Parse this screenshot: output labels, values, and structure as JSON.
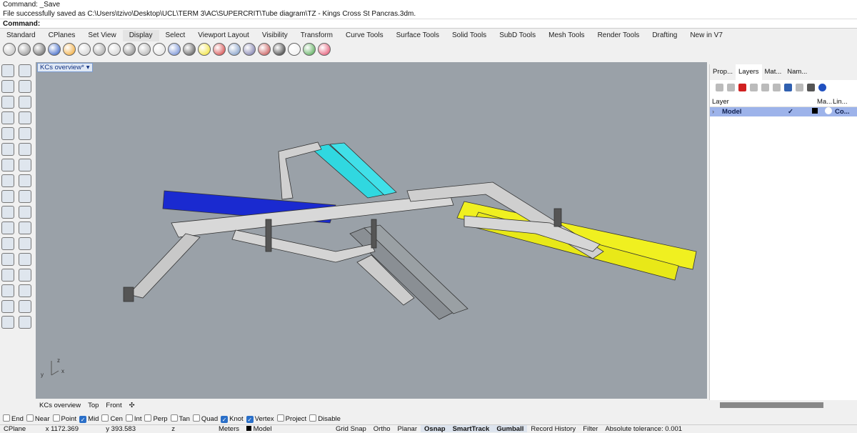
{
  "command": {
    "line1": "Command: _Save",
    "line2": "File successfully saved as C:\\Users\\tzivo\\Desktop\\UCL\\TERM 3\\AC\\SUPERCRIT\\Tube diagram\\TZ - Kings Cross St Pancras.3dm.",
    "prompt": "Command:"
  },
  "toolbar_tabs": [
    "Standard",
    "CPlanes",
    "Set View",
    "Display",
    "Select",
    "Viewport Layout",
    "Visibility",
    "Transform",
    "Curve Tools",
    "Surface Tools",
    "Solid Tools",
    "SubD Tools",
    "Mesh Tools",
    "Render Tools",
    "Drafting",
    "New in V7"
  ],
  "active_toolbar_tab": "Display",
  "display_icons": [
    "#b8b8b8",
    "#888",
    "#555",
    "#2050c0",
    "#f0a020",
    "#ccc",
    "#999",
    "#ccc",
    "#777",
    "#aaa",
    "#ddd",
    "#6080d0",
    "#444",
    "#f0e020",
    "#d03030",
    "#7090c0",
    "#6a6aa0",
    "#c04040",
    "#222",
    "#eee",
    "#40a040",
    "#e04060"
  ],
  "viewport": {
    "title": "KCs overview*",
    "background": "#9aa1a8",
    "axis_labels": {
      "z": "z",
      "y": "y",
      "x": "x"
    }
  },
  "panel": {
    "tabs": [
      "Prop...",
      "Layers",
      "Mat...",
      "Nam..."
    ],
    "active_tab": "Layers",
    "columns": [
      "Layer",
      "Ma...",
      "Lin..."
    ],
    "layers": [
      {
        "name": "Model",
        "current": "✓",
        "linetype": "Co..."
      }
    ]
  },
  "viewport_tabs": [
    "KCs overview",
    "Top",
    "Front"
  ],
  "osnap": [
    {
      "label": "End",
      "checked": false
    },
    {
      "label": "Near",
      "checked": false
    },
    {
      "label": "Point",
      "checked": false
    },
    {
      "label": "Mid",
      "checked": true
    },
    {
      "label": "Cen",
      "checked": false
    },
    {
      "label": "Int",
      "checked": false
    },
    {
      "label": "Perp",
      "checked": false
    },
    {
      "label": "Tan",
      "checked": false
    },
    {
      "label": "Quad",
      "checked": false
    },
    {
      "label": "Knot",
      "checked": true
    },
    {
      "label": "Vertex",
      "checked": true
    },
    {
      "label": "Project",
      "checked": false
    },
    {
      "label": "Disable",
      "checked": false
    }
  ],
  "status": {
    "cplane": "CPlane",
    "x": "x 1172.369",
    "y": "y 393.583",
    "z": "z",
    "units": "Meters",
    "layer": "Model",
    "grid_snap": "Grid Snap",
    "ortho": "Ortho",
    "planar": "Planar",
    "osnap": "Osnap",
    "smarttrack": "SmartTrack",
    "gumball": "Gumball",
    "record_history": "Record History",
    "filter": "Filter",
    "tolerance": "Absolute tolerance: 0.001"
  }
}
